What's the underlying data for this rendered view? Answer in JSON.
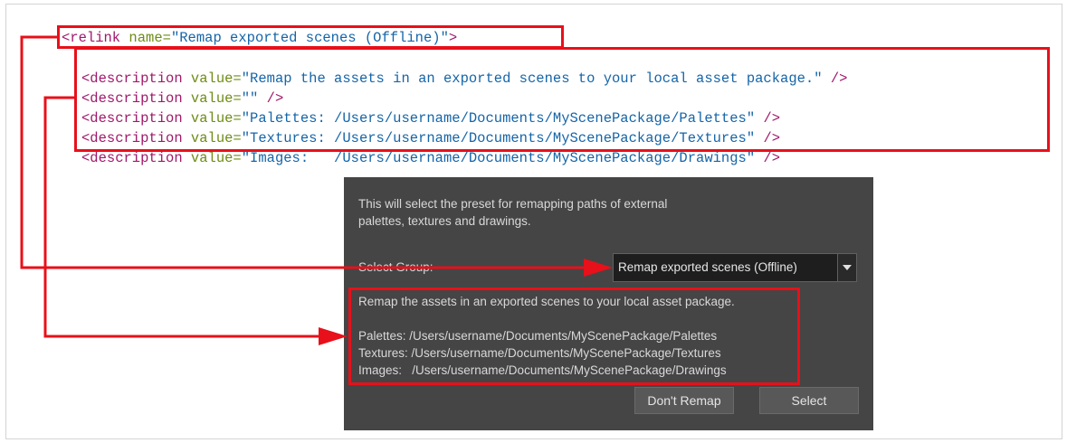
{
  "code": {
    "relink_open": "<relink ",
    "relink_name_attr": "name=",
    "relink_name_value": "\"Remap exported scenes (Offline)\"",
    "relink_close": ">",
    "lines": [
      {
        "tag": "<description ",
        "attr": "value=",
        "value": "\"Remap the assets in an exported scenes to your local asset package.\"",
        "end": " />"
      },
      {
        "tag": "<description ",
        "attr": "value=",
        "value": "\"\"",
        "end": " />"
      },
      {
        "tag": "<description ",
        "attr": "value=",
        "value": "\"Palettes: /Users/username/Documents/MyScenePackage/Palettes\"",
        "end": " />"
      },
      {
        "tag": "<description ",
        "attr": "value=",
        "value": "\"Textures: /Users/username/Documents/MyScenePackage/Textures\"",
        "end": " />"
      },
      {
        "tag": "<description ",
        "attr": "value=",
        "value": "\"Images:   /Users/username/Documents/MyScenePackage/Drawings\"",
        "end": " />"
      }
    ]
  },
  "dialog": {
    "intro_line1": "This will select the preset for remapping paths of external",
    "intro_line2": "palettes, textures and drawings.",
    "select_group_label": "Select Group:",
    "combo_value": "Remap exported scenes (Offline)",
    "description_lines": [
      "Remap the assets in an exported scenes to your local asset package.",
      "",
      "Palettes: /Users/username/Documents/MyScenePackage/Palettes",
      "Textures: /Users/username/Documents/MyScenePackage/Textures",
      "Images:   /Users/username/Documents/MyScenePackage/Drawings"
    ],
    "dont_remap_label": "Don't Remap",
    "select_label": "Select"
  },
  "colors": {
    "highlight": "#e8101a",
    "dialog_bg": "#454545",
    "tag": "#a0196b",
    "attr": "#6e8c16",
    "value": "#1565a8"
  }
}
